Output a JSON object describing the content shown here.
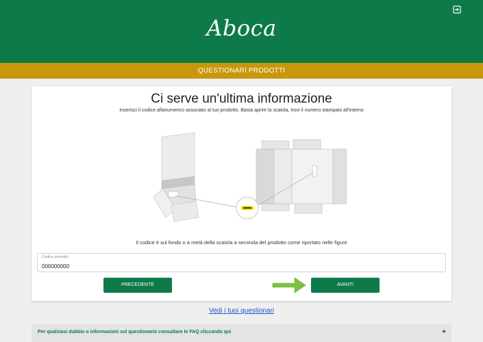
{
  "header": {
    "logo_text": "Aboca",
    "logout_icon": "logout-icon"
  },
  "banner": {
    "title": "QUESTIONARI PRODOTTI"
  },
  "card": {
    "heading": "Ci serve un'ultima informazione",
    "subtitle": "Inserisci il codice alfanumerico associato al tuo prodotto. Basta aprire la scatola, trovi il numero stampato all'interno",
    "note": "Il codice è sul fondo o a metà della scatola a seconda del prodotto come riportato nelle figure",
    "field": {
      "label": "Codice prodotto",
      "value": "000000000"
    },
    "prev_label": "PRECEDENTE",
    "next_label": "AVANTI"
  },
  "link_text": "Vedi i tuoi questionari",
  "faq": {
    "text": "Per qualsiasi dubbio o informazioni sul questionario consultare le FAQ cliccando qui",
    "expand_symbol": "+"
  },
  "colors": {
    "brand_green": "#0e7a4a",
    "gold": "#c9970b",
    "link_blue": "#1a55c9",
    "arrow_green": "#7fc241"
  }
}
